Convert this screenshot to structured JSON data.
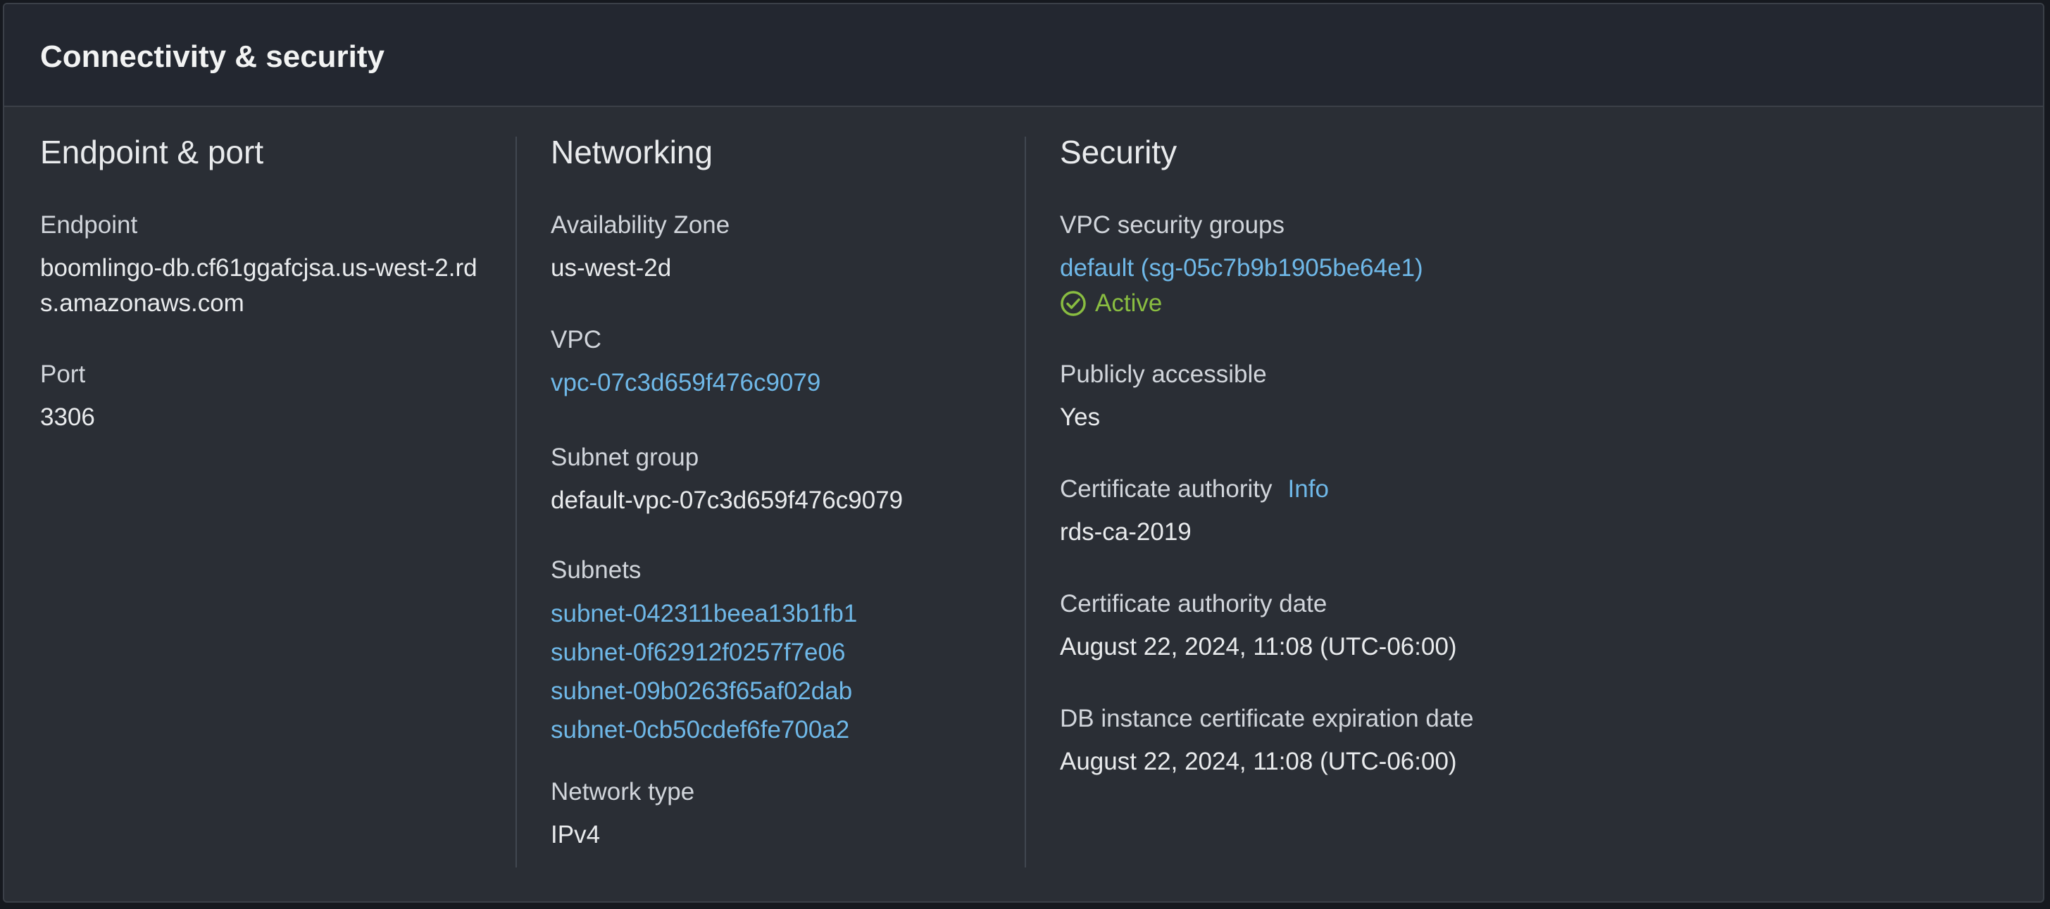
{
  "panel": {
    "title": "Connectivity & security"
  },
  "endpoint_port": {
    "heading": "Endpoint & port",
    "endpoint_label": "Endpoint",
    "endpoint_value": "boomlingo-db.cf61ggafcjsa.us-west-2.rds.amazonaws.com",
    "port_label": "Port",
    "port_value": "3306"
  },
  "networking": {
    "heading": "Networking",
    "az_label": "Availability Zone",
    "az_value": "us-west-2d",
    "vpc_label": "VPC",
    "vpc_value": "vpc-07c3d659f476c9079",
    "subnet_group_label": "Subnet group",
    "subnet_group_value": "default-vpc-07c3d659f476c9079",
    "subnets_label": "Subnets",
    "subnets": [
      "subnet-042311beea13b1fb1",
      "subnet-0f62912f0257f7e06",
      "subnet-09b0263f65af02dab",
      "subnet-0cb50cdef6fe700a2"
    ],
    "network_type_label": "Network type",
    "network_type_value": "IPv4"
  },
  "security": {
    "heading": "Security",
    "vpc_sg_label": "VPC security groups",
    "vpc_sg_value": "default (sg-05c7b9b1905be64e1)",
    "vpc_sg_status": "Active",
    "vpc_sg_status_icon": "check-circle-icon",
    "publicly_accessible_label": "Publicly accessible",
    "publicly_accessible_value": "Yes",
    "cert_authority_label": "Certificate authority",
    "cert_authority_info": "Info",
    "cert_authority_value": "rds-ca-2019",
    "cert_authority_date_label": "Certificate authority date",
    "cert_authority_date_value": "August 22, 2024, 11:08 (UTC-06:00)",
    "db_cert_expiration_label": "DB instance certificate expiration date",
    "db_cert_expiration_value": "August 22, 2024, 11:08 (UTC-06:00)"
  },
  "colors": {
    "background": "#2a2e35",
    "header_background": "#232730",
    "link": "#6fb8e8",
    "status_success": "#89bd41",
    "text": "#e9ebed"
  }
}
